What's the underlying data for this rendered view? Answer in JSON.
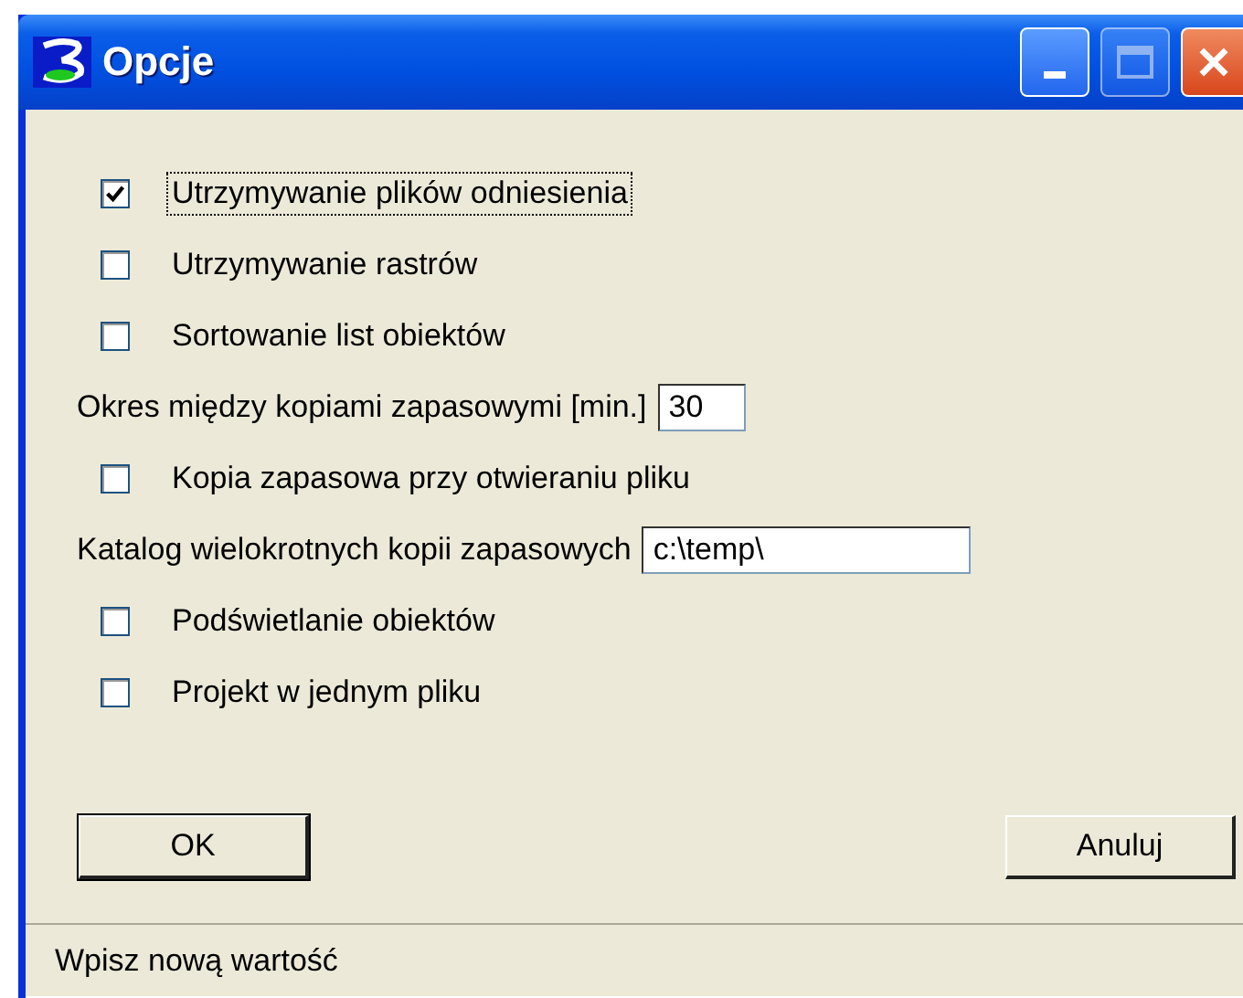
{
  "window": {
    "title": "Opcje",
    "title_buttons": [
      {
        "kind": "minimize",
        "disabled": false
      },
      {
        "kind": "maximize",
        "disabled": true
      },
      {
        "kind": "close",
        "disabled": false
      }
    ]
  },
  "options": [
    {
      "kind": "checkbox",
      "label": "Utrzymywanie plików odniesienia",
      "checked": true,
      "focused": true
    },
    {
      "kind": "checkbox",
      "label": "Utrzymywanie rastrów",
      "checked": false,
      "focused": false
    },
    {
      "kind": "checkbox",
      "label": "Sortowanie list obiektów",
      "checked": false,
      "focused": false
    },
    {
      "kind": "number",
      "label": "Okres między kopiami zapasowymi [min.]",
      "value": "30"
    },
    {
      "kind": "checkbox",
      "label": "Kopia zapasowa przy otwieraniu pliku",
      "checked": false,
      "focused": false
    },
    {
      "kind": "text",
      "label": "Katalog wielokrotnych kopii zapasowych",
      "value": "c:\\temp\\"
    },
    {
      "kind": "checkbox",
      "label": "Podświetlanie obiektów",
      "checked": false,
      "focused": false
    },
    {
      "kind": "checkbox",
      "label": "Projekt w jednym pliku",
      "checked": false,
      "focused": false
    }
  ],
  "buttons": [
    {
      "label": "OK",
      "default": true
    },
    {
      "label": "Anuluj",
      "default": false
    }
  ],
  "status_bar": "Wpisz nową wartość"
}
